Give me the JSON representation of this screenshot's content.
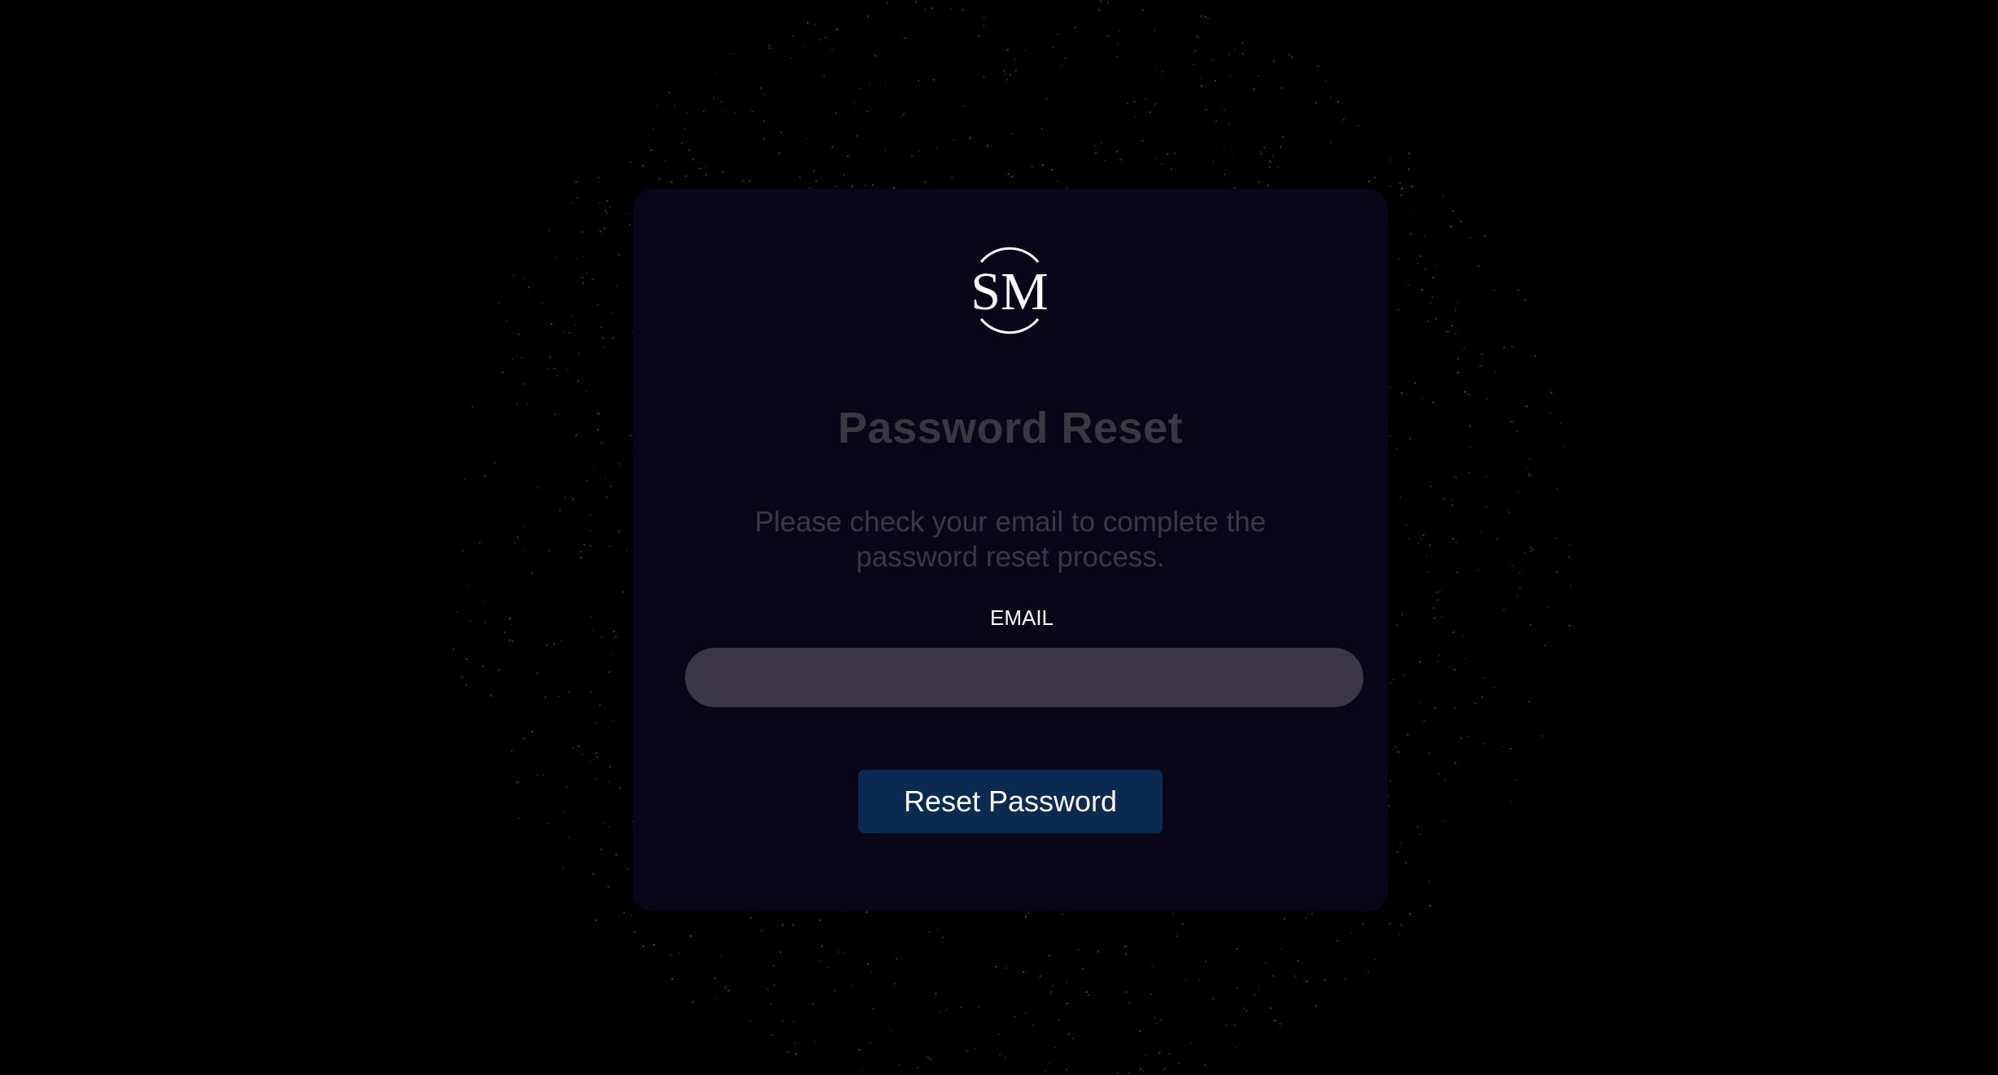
{
  "brand": {
    "logo_text": "SM",
    "logo_icon": "sm-monogram-logo"
  },
  "form": {
    "title": "Password Reset",
    "instructions": "Please check your email to complete the password reset process.",
    "email_label": "EMAIL",
    "email_value": "",
    "email_placeholder": "",
    "submit_label": "Reset Password"
  },
  "colors": {
    "background": "#000000",
    "card": "#0a0619",
    "input": "#3c3747",
    "button": "#0b2a52",
    "particles": [
      "#2f7a3a",
      "#6d2a7a",
      "#2a5a8a",
      "#7a3a2a",
      "#3a6a2a",
      "#8a2a4a"
    ]
  }
}
